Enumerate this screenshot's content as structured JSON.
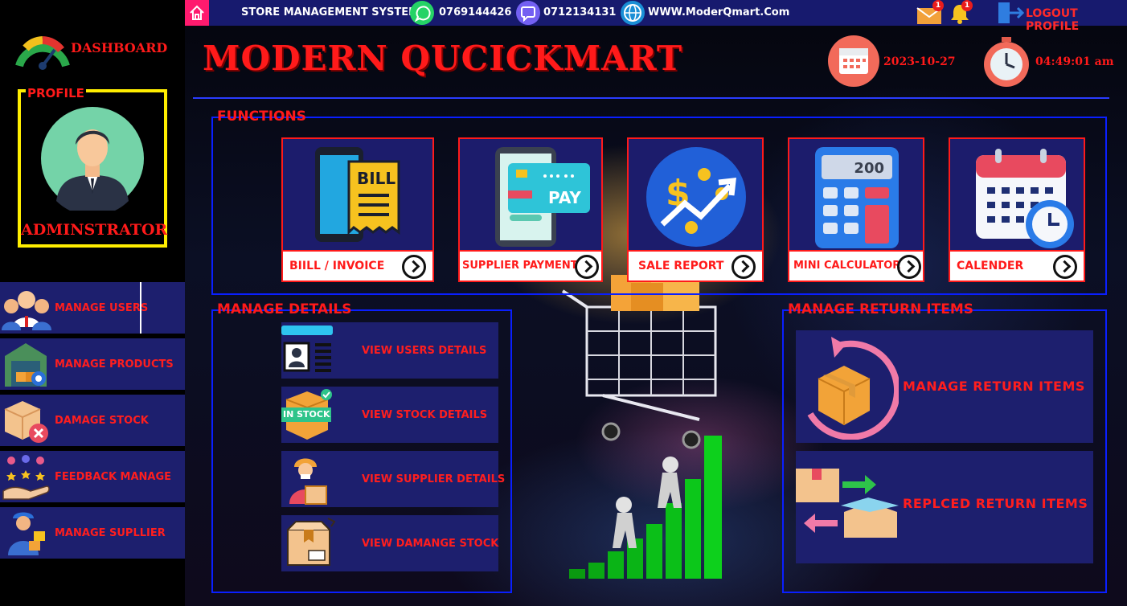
{
  "topbar": {
    "system_title": "STORE MANAGEMENT SYSTEM",
    "whatsapp_number": "0769144426",
    "viber_number": "0712134131",
    "website": "WWW.ModerQmart.Com",
    "mail_badge": "1",
    "bell_badge": "1",
    "logout_label": "LOGOUT PROFILE"
  },
  "sidebar": {
    "dashboard_label": "DASHBOARD",
    "profile_title": "PROFILE",
    "profile_role": "ADMINSTRATOR",
    "items": [
      {
        "label": "MANAGE USERS",
        "icon": "users-group-icon"
      },
      {
        "label": "MANAGE PRODUCTS",
        "icon": "warehouse-icon"
      },
      {
        "label": "DAMAGE STOCK",
        "icon": "damaged-box-icon"
      },
      {
        "label": "FEEDBACK MANAGE",
        "icon": "feedback-icon"
      },
      {
        "label": "MANAGE SUPLLIER",
        "icon": "supplier-icon"
      }
    ]
  },
  "header": {
    "app_title": "MODERN QUCICKMART",
    "date": "2023-10-27",
    "time": "04:49:01 am"
  },
  "functions": {
    "title": "FUNCTIONS",
    "cards": [
      {
        "label": "BIILL  / INVOICE",
        "icon": "bill-icon"
      },
      {
        "label": "SUPPLIER PAYMENT",
        "icon": "payment-icon"
      },
      {
        "label": "SALE REPORT",
        "icon": "sales-report-icon"
      },
      {
        "label": "MINI CALCULATOR",
        "icon": "calculator-icon",
        "display": "200"
      },
      {
        "label": "CALENDER",
        "icon": "calendar-icon"
      }
    ]
  },
  "details": {
    "title": "MANAGE DETAILS",
    "items": [
      {
        "label": "VIEW USERS DETAILS",
        "icon": "id-card-icon"
      },
      {
        "label": "VIEW STOCK DETAILS",
        "icon": "in-stock-icon",
        "badge": "IN STOCK"
      },
      {
        "label": "VIEW SUPPLIER DETAILS",
        "icon": "delivery-man-icon"
      },
      {
        "label": "VIEW DAMANGE STOCK",
        "icon": "damaged-stock-icon"
      }
    ]
  },
  "returns": {
    "title": "MANAGE RETURN ITEMS",
    "items": [
      {
        "label": "MANAGE RETURN ITEMS",
        "icon": "return-box-icon"
      },
      {
        "label": "REPLCED RETURN ITEMS",
        "icon": "replace-box-icon"
      }
    ]
  },
  "colors": {
    "accent_red": "#ff1a1a",
    "panel_blue": "#1d1f6e",
    "frame_blue": "#0a1fff",
    "topbar": "#171a6e"
  }
}
